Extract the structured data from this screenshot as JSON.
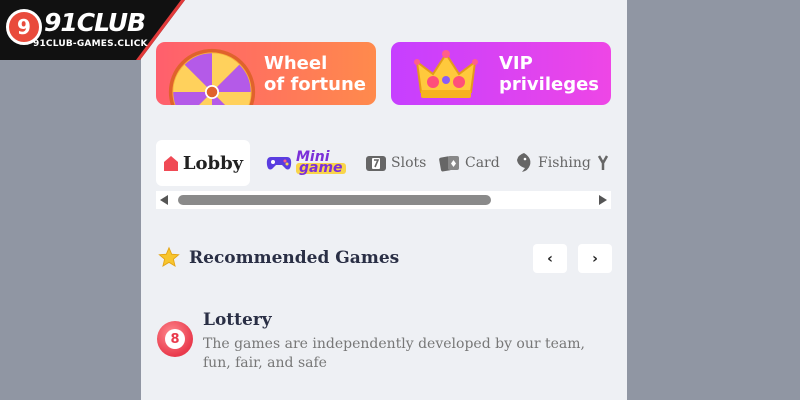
{
  "logo": {
    "mark": "9",
    "name": "91CLUB",
    "domain": "91CLUB-GAMES.CLICK"
  },
  "banners": [
    {
      "line1": "Wheel",
      "line2": "of fortune",
      "icon": "wheel-icon"
    },
    {
      "line1": "VIP",
      "line2": "privileges",
      "icon": "crown-icon"
    }
  ],
  "tabs": [
    {
      "label": "Lobby",
      "icon": "house-icon",
      "active": true
    },
    {
      "label_top": "Mini",
      "label_bottom": "game",
      "icon": "gamepad-icon"
    },
    {
      "label": "Slots",
      "icon": "slot-machine-icon"
    },
    {
      "label": "Card",
      "icon": "cards-icon"
    },
    {
      "label": "Fishing",
      "icon": "fish-icon"
    }
  ],
  "recommended": {
    "title": "Recommended Games",
    "icon": "star-icon",
    "prev": "‹",
    "next": "›"
  },
  "lottery": {
    "badge": "8",
    "title": "Lottery",
    "description": "The games are independently developed by our team, fun, fair, and safe"
  },
  "colors": {
    "wheel_banner": "#ff6b5f",
    "vip_banner": "#d943f5",
    "lottery": "#e93a4c",
    "background": "#9096a3",
    "panel": "#eef0f4"
  }
}
